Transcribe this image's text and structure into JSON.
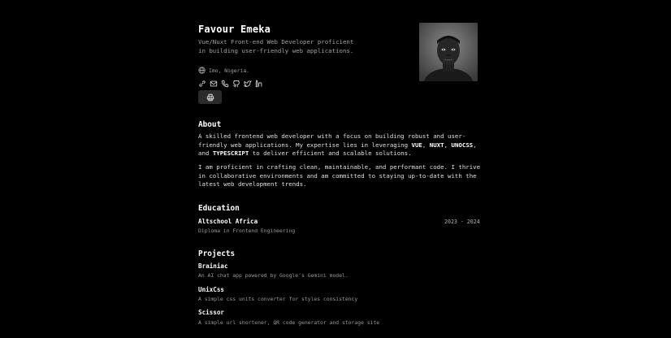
{
  "header": {
    "name": "Favour Emeka",
    "tagline": "Vue/Nuxt Front-end Web Developer proficient in building user-friendly web applications.",
    "location": "Imo, Nigeria.",
    "contact_icons": [
      "link-icon",
      "mail-icon",
      "phone-icon",
      "github-icon",
      "twitter-icon",
      "linkedin-icon"
    ],
    "print_icon": "printer-icon"
  },
  "about": {
    "heading": "About",
    "p1_prefix": "A skilled frontend web developer with a focus on building robust and user-friendly web applications. My expertise lies in leveraging ",
    "skill_1": "VUE",
    "sep_1": ", ",
    "skill_2": "NUXT",
    "sep_2": ", ",
    "skill_3": "UNOCSS",
    "sep_3": ", and ",
    "skill_4": "TYPESCRIPT",
    "p1_suffix": " to deliver efficient and scalable solutions.",
    "p2": "I am proficient in crafting clean, maintainable, and performant code. I thrive in collaborative environments and am committed to staying up-to-date with the latest web development trends."
  },
  "education": {
    "heading": "Education",
    "school": "Altschool Africa",
    "dates": "2023 - 2024",
    "degree": "Diploma in Frontend Engineering"
  },
  "projects": {
    "heading": "Projects",
    "items": [
      {
        "name": "Brainiac",
        "description": "An AI chat app powered by Google's Gemini model."
      },
      {
        "name": "UnixCss",
        "description": "A simple css units converter for styles consistency"
      },
      {
        "name": "Scissor",
        "description": "A simple url shortener, QR code generator and storage site"
      }
    ]
  },
  "colors": {
    "background": "#000000",
    "text": "#ffffff",
    "muted": "#9a9a9a",
    "button": "#2b2b2b"
  }
}
